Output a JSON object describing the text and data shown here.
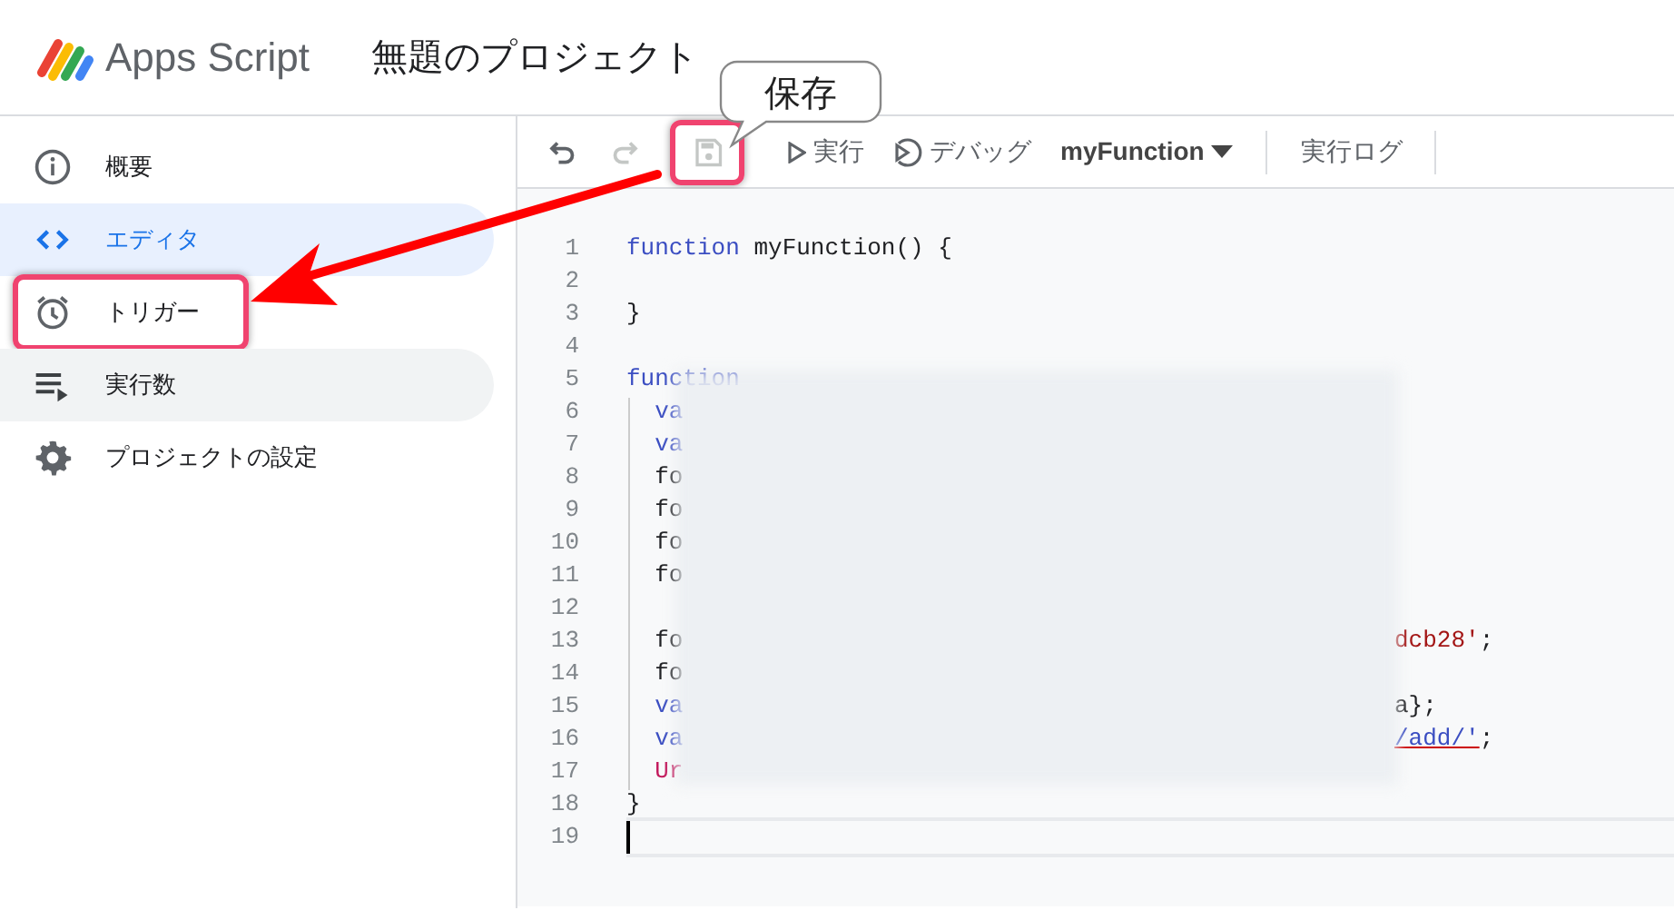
{
  "header": {
    "app_name": "Apps Script",
    "project_title": "無題のプロジェクト"
  },
  "sidebar": {
    "items": [
      {
        "label": "概要",
        "selected": false,
        "hovered": false,
        "highlighted": false
      },
      {
        "label": "エディタ",
        "selected": true,
        "hovered": false,
        "highlighted": false
      },
      {
        "label": "トリガー",
        "selected": false,
        "hovered": false,
        "highlighted": true
      },
      {
        "label": "実行数",
        "selected": false,
        "hovered": true,
        "highlighted": false
      },
      {
        "label": "プロジェクトの設定",
        "selected": false,
        "hovered": false,
        "highlighted": false
      }
    ]
  },
  "toolbar": {
    "undo": {
      "disabled": false
    },
    "redo": {
      "disabled": true
    },
    "save": {
      "disabled": true,
      "highlighted": true
    },
    "run": "実行",
    "debug": "デバッグ",
    "function_select": "myFunction",
    "log": "実行ログ"
  },
  "callout": {
    "text": "保存"
  },
  "editor": {
    "lines": [
      {
        "number": "1",
        "code": [
          {
            "kind": "keyword",
            "text": "function"
          },
          {
            "kind": "plain",
            "text": " myFunction() {"
          }
        ]
      },
      {
        "number": "2"
      },
      {
        "number": "3",
        "code": [
          {
            "kind": "plain",
            "text": "}"
          }
        ]
      },
      {
        "number": "4"
      },
      {
        "number": "5",
        "code": [
          {
            "kind": "keyword",
            "text": "function"
          }
        ]
      },
      {
        "number": "6",
        "code": [
          {
            "kind": "keyword",
            "text": "  va"
          }
        ]
      },
      {
        "number": "7",
        "code": [
          {
            "kind": "keyword",
            "text": "  va"
          }
        ]
      },
      {
        "number": "8",
        "code": [
          {
            "kind": "plain",
            "text": "  fo"
          }
        ]
      },
      {
        "number": "9",
        "code": [
          {
            "kind": "plain",
            "text": "  fo"
          }
        ]
      },
      {
        "number": "10",
        "code": [
          {
            "kind": "plain",
            "text": "  fo"
          }
        ]
      },
      {
        "number": "11",
        "code": [
          {
            "kind": "plain",
            "text": "  fo"
          }
        ]
      },
      {
        "number": "12"
      },
      {
        "number": "13",
        "code": [
          {
            "kind": "plain",
            "text": "  fo"
          }
        ],
        "after": [
          {
            "kind": "string",
            "text": "dcb28'"
          },
          {
            "kind": "plain",
            "text": ";"
          }
        ]
      },
      {
        "number": "14",
        "code": [
          {
            "kind": "plain",
            "text": "  fo"
          }
        ]
      },
      {
        "number": "15",
        "code": [
          {
            "kind": "keyword",
            "text": "  va"
          }
        ],
        "after": [
          {
            "kind": "plain",
            "text": "a};"
          }
        ]
      },
      {
        "number": "16",
        "code": [
          {
            "kind": "keyword",
            "text": "  va"
          }
        ],
        "after": [
          {
            "kind": "link",
            "text": "/add/'"
          },
          {
            "kind": "plain",
            "text": ";"
          }
        ]
      },
      {
        "number": "17",
        "code": [
          {
            "kind": "error",
            "text": "  Ur"
          }
        ]
      },
      {
        "number": "18",
        "code": [
          {
            "kind": "plain",
            "text": "}"
          }
        ]
      },
      {
        "number": "19",
        "current": true
      }
    ]
  }
}
